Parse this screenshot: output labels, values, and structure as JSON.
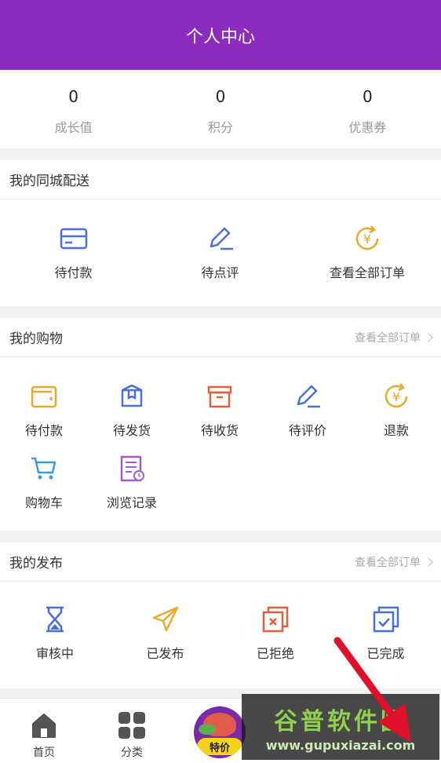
{
  "header": {
    "title": "个人中心"
  },
  "stats": [
    {
      "value": "0",
      "label": "成长值"
    },
    {
      "value": "0",
      "label": "积分"
    },
    {
      "value": "0",
      "label": "优惠券"
    }
  ],
  "sections": {
    "local": {
      "title": "我的同城配送",
      "items": [
        {
          "label": "待付款",
          "icon": "card-icon"
        },
        {
          "label": "待点评",
          "icon": "pen-icon"
        },
        {
          "label": "查看全部订单",
          "icon": "yen-refresh-icon"
        }
      ]
    },
    "shopping": {
      "title": "我的购物",
      "more": "查看全部订单",
      "items": [
        {
          "label": "待付款",
          "icon": "wallet-icon"
        },
        {
          "label": "待发货",
          "icon": "package-icon"
        },
        {
          "label": "待收货",
          "icon": "box-icon"
        },
        {
          "label": "待评价",
          "icon": "pen-icon"
        },
        {
          "label": "退款",
          "icon": "yen-refresh-icon"
        },
        {
          "label": "购物车",
          "icon": "cart-icon"
        },
        {
          "label": "浏览记录",
          "icon": "history-icon"
        }
      ]
    },
    "publish": {
      "title": "我的发布",
      "more": "查看全部订单",
      "items": [
        {
          "label": "审核中",
          "icon": "hourglass-icon"
        },
        {
          "label": "已发布",
          "icon": "send-icon"
        },
        {
          "label": "已拒绝",
          "icon": "reject-icon"
        },
        {
          "label": "已完成",
          "icon": "done-icon"
        }
      ]
    }
  },
  "tabbar": {
    "items": [
      {
        "label": "首页",
        "icon": "home-icon"
      },
      {
        "label": "分类",
        "icon": "category-icon"
      },
      {
        "label": "特价",
        "icon": "special-offer-icon"
      }
    ]
  },
  "watermark": {
    "text": "谷普软件园",
    "url": "www.gupuxiazai.com"
  },
  "colors": {
    "header": "#8b2bbf",
    "accent_blue": "#4a6fd6",
    "accent_orange": "#e9a92d",
    "accent_red": "#e0603f",
    "arrow": "#e0102a"
  }
}
